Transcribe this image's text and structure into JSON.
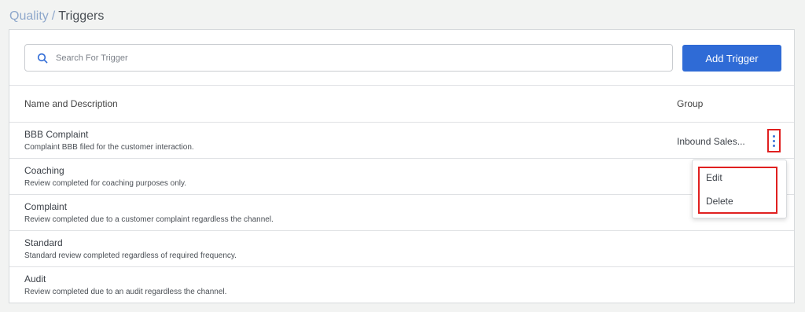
{
  "breadcrumb": {
    "parent": "Quality",
    "separator": "/",
    "current": "Triggers"
  },
  "search": {
    "placeholder": "Search For Trigger",
    "value": ""
  },
  "actions": {
    "add_label": "Add Trigger"
  },
  "table": {
    "columns": {
      "name": "Name and Description",
      "group": "Group"
    },
    "rows": [
      {
        "title": "BBB Complaint",
        "description": "Complaint BBB filed for the customer interaction.",
        "group": "Inbound Sales..."
      },
      {
        "title": "Coaching",
        "description": "Review completed for coaching purposes only.",
        "group": ""
      },
      {
        "title": "Complaint",
        "description": "Review completed due to a customer complaint regardless the channel.",
        "group": ""
      },
      {
        "title": "Standard",
        "description": "Standard review completed regardless of required frequency.",
        "group": ""
      },
      {
        "title": "Audit",
        "description": "Review completed due to an audit regardless the channel.",
        "group": ""
      }
    ]
  },
  "context_menu": {
    "items": [
      "Edit",
      "Delete"
    ]
  },
  "colors": {
    "primary": "#2f6bd6",
    "highlight": "#e02020",
    "breadcrumb_link": "#8fa8cc"
  }
}
